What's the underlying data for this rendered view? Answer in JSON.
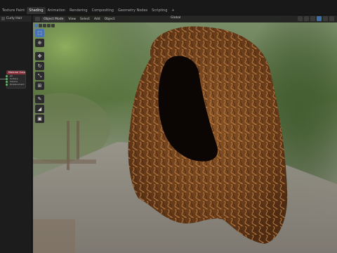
{
  "workspace_tabs": [
    {
      "label": "Texture Paint",
      "active": false
    },
    {
      "label": "Shading",
      "active": true
    },
    {
      "label": "Animation",
      "active": false
    },
    {
      "label": "Rendering",
      "active": false
    },
    {
      "label": "Compositing",
      "active": false
    },
    {
      "label": "Geometry Nodes",
      "active": false
    },
    {
      "label": "Scripting",
      "active": false
    },
    {
      "label": "+",
      "active": false
    }
  ],
  "node_editor": {
    "object_label": "Curly Hair",
    "node_title": "Material Output",
    "node_rows": [
      "All",
      "Surface",
      "Volume",
      "Displacement"
    ]
  },
  "viewport": {
    "mode": "Object Mode",
    "menu": [
      "View",
      "Select",
      "Add",
      "Object"
    ],
    "orientation": "Global"
  },
  "toolbar": {
    "tools": [
      {
        "name": "select-box",
        "glyph": "⬚",
        "active": true
      },
      {
        "name": "cursor",
        "glyph": "⊕",
        "active": false
      },
      {
        "name": "move",
        "glyph": "✥",
        "active": false
      },
      {
        "name": "rotate",
        "glyph": "↻",
        "active": false
      },
      {
        "name": "scale",
        "glyph": "⤡",
        "active": false
      },
      {
        "name": "transform",
        "glyph": "⊞",
        "active": false
      },
      {
        "name": "annotate",
        "glyph": "✎",
        "active": false
      },
      {
        "name": "measure",
        "glyph": "◢",
        "active": false
      },
      {
        "name": "add-cube",
        "glyph": "▣",
        "active": false
      }
    ]
  },
  "colors": {
    "accent": "#4772b3",
    "hair_base": "#6b3f1c",
    "hair_highlight": "#c88a4f",
    "background_foliage": "#4e6a34"
  }
}
